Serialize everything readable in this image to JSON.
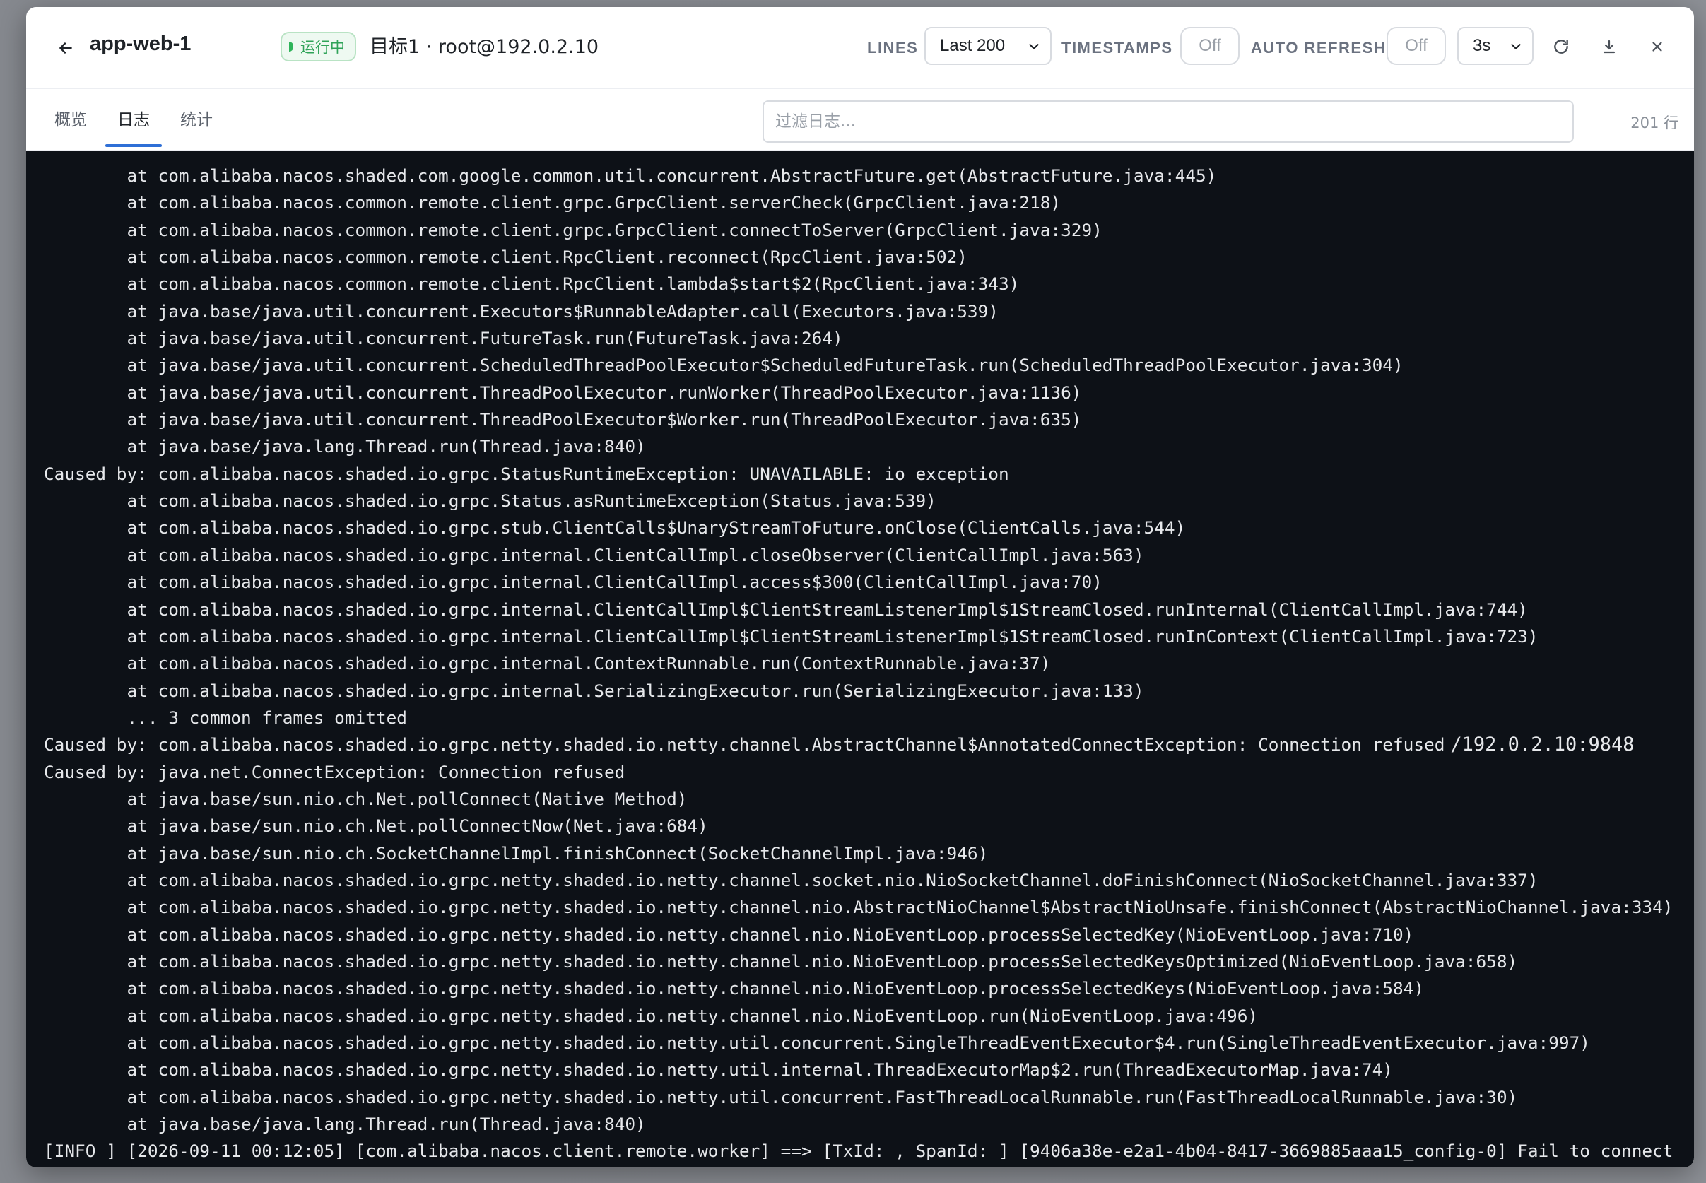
{
  "header": {
    "back_icon": "arrow-left-icon",
    "app_name": "app-web-1",
    "status": "运行中",
    "target": "目标1 · root@192.0.2.10",
    "lines_label": "LINES",
    "lines_value": "Last 200",
    "timestamps_label": "TIMESTAMPS",
    "timestamps_value": "Off",
    "auto_refresh_label": "AUTO REFRESH",
    "auto_refresh_value": "Off",
    "interval_value": "3s",
    "refresh_icon": "refresh-icon",
    "download_icon": "download-icon",
    "close_icon": "close-icon"
  },
  "tabs": [
    {
      "label": "概览",
      "active": false
    },
    {
      "label": "日志",
      "active": true
    },
    {
      "label": "统计",
      "active": false
    }
  ],
  "filter": {
    "placeholder": "过滤日志...",
    "value": ""
  },
  "line_count": "201 行",
  "log_lines": [
    {
      "text": "        at com.alibaba.nacos.shaded.com.google.common.util.concurrent.AbstractFuture.get(AbstractFuture.java:445)"
    },
    {
      "text": "        at com.alibaba.nacos.common.remote.client.grpc.GrpcClient.serverCheck(GrpcClient.java:218)"
    },
    {
      "text": "        at com.alibaba.nacos.common.remote.client.grpc.GrpcClient.connectToServer(GrpcClient.java:329)"
    },
    {
      "text": "        at com.alibaba.nacos.common.remote.client.RpcClient.reconnect(RpcClient.java:502)"
    },
    {
      "text": "        at com.alibaba.nacos.common.remote.client.RpcClient.lambda$start$2(RpcClient.java:343)"
    },
    {
      "text": "        at java.base/java.util.concurrent.Executors$RunnableAdapter.call(Executors.java:539)"
    },
    {
      "text": "        at java.base/java.util.concurrent.FutureTask.run(FutureTask.java:264)"
    },
    {
      "text": "        at java.base/java.util.concurrent.ScheduledThreadPoolExecutor$ScheduledFutureTask.run(ScheduledThreadPoolExecutor.java:304)"
    },
    {
      "text": "        at java.base/java.util.concurrent.ThreadPoolExecutor.runWorker(ThreadPoolExecutor.java:1136)"
    },
    {
      "text": "        at java.base/java.util.concurrent.ThreadPoolExecutor$Worker.run(ThreadPoolExecutor.java:635)"
    },
    {
      "text": "        at java.base/java.lang.Thread.run(Thread.java:840)"
    },
    {
      "text": "Caused by: com.alibaba.nacos.shaded.io.grpc.StatusRuntimeException: UNAVAILABLE: io exception"
    },
    {
      "text": "        at com.alibaba.nacos.shaded.io.grpc.Status.asRuntimeException(Status.java:539)"
    },
    {
      "text": "        at com.alibaba.nacos.shaded.io.grpc.stub.ClientCalls$UnaryStreamToFuture.onClose(ClientCalls.java:544)"
    },
    {
      "text": "        at com.alibaba.nacos.shaded.io.grpc.internal.ClientCallImpl.closeObserver(ClientCallImpl.java:563)"
    },
    {
      "text": "        at com.alibaba.nacos.shaded.io.grpc.internal.ClientCallImpl.access$300(ClientCallImpl.java:70)"
    },
    {
      "text": "        at com.alibaba.nacos.shaded.io.grpc.internal.ClientCallImpl$ClientStreamListenerImpl$1StreamClosed.runInternal(ClientCallImpl.java:744)"
    },
    {
      "text": "        at com.alibaba.nacos.shaded.io.grpc.internal.ClientCallImpl$ClientStreamListenerImpl$1StreamClosed.runInContext(ClientCallImpl.java:723)"
    },
    {
      "text": "        at com.alibaba.nacos.shaded.io.grpc.internal.ContextRunnable.run(ContextRunnable.java:37)"
    },
    {
      "text": "        at com.alibaba.nacos.shaded.io.grpc.internal.SerializingExecutor.run(SerializingExecutor.java:133)"
    },
    {
      "text": "        ... 3 common frames omitted"
    },
    {
      "text": "Caused by: com.alibaba.nacos.shaded.io.grpc.netty.shaded.io.netty.channel.AbstractChannel$AnnotatedConnectException: Connection refused",
      "suffix": "/192.0.2.10:9848"
    },
    {
      "text": "Caused by: java.net.ConnectException: Connection refused"
    },
    {
      "text": "        at java.base/sun.nio.ch.Net.pollConnect(Native Method)"
    },
    {
      "text": "        at java.base/sun.nio.ch.Net.pollConnectNow(Net.java:684)"
    },
    {
      "text": "        at java.base/sun.nio.ch.SocketChannelImpl.finishConnect(SocketChannelImpl.java:946)"
    },
    {
      "text": "        at com.alibaba.nacos.shaded.io.grpc.netty.shaded.io.netty.channel.socket.nio.NioSocketChannel.doFinishConnect(NioSocketChannel.java:337)"
    },
    {
      "text": "        at com.alibaba.nacos.shaded.io.grpc.netty.shaded.io.netty.channel.nio.AbstractNioChannel$AbstractNioUnsafe.finishConnect(AbstractNioChannel.java:334)"
    },
    {
      "text": "        at com.alibaba.nacos.shaded.io.grpc.netty.shaded.io.netty.channel.nio.NioEventLoop.processSelectedKey(NioEventLoop.java:710)"
    },
    {
      "text": "        at com.alibaba.nacos.shaded.io.grpc.netty.shaded.io.netty.channel.nio.NioEventLoop.processSelectedKeysOptimized(NioEventLoop.java:658)"
    },
    {
      "text": "        at com.alibaba.nacos.shaded.io.grpc.netty.shaded.io.netty.channel.nio.NioEventLoop.processSelectedKeys(NioEventLoop.java:584)"
    },
    {
      "text": "        at com.alibaba.nacos.shaded.io.grpc.netty.shaded.io.netty.channel.nio.NioEventLoop.run(NioEventLoop.java:496)"
    },
    {
      "text": "        at com.alibaba.nacos.shaded.io.grpc.netty.shaded.io.netty.util.concurrent.SingleThreadEventExecutor$4.run(SingleThreadEventExecutor.java:997)"
    },
    {
      "text": "        at com.alibaba.nacos.shaded.io.grpc.netty.shaded.io.netty.util.internal.ThreadExecutorMap$2.run(ThreadExecutorMap.java:74)"
    },
    {
      "text": "        at com.alibaba.nacos.shaded.io.grpc.netty.shaded.io.netty.util.concurrent.FastThreadLocalRunnable.run(FastThreadLocalRunnable.java:30)"
    },
    {
      "text": "        at java.base/java.lang.Thread.run(Thread.java:840)"
    },
    {
      "text": "[INFO ] [2026-09-11 00:12:05] [com.alibaba.nacos.client.remote.worker] ==> [TxId: , SpanId: ] [9406a38e-e2a1-4b04-8417-3669885aaa15_config-0] Fail to connect"
    }
  ],
  "colors": {
    "log_bg": "#0d1117",
    "log_text": "#e6e8eb",
    "accent": "#2f6fd6",
    "status_green": "#2fa358"
  }
}
